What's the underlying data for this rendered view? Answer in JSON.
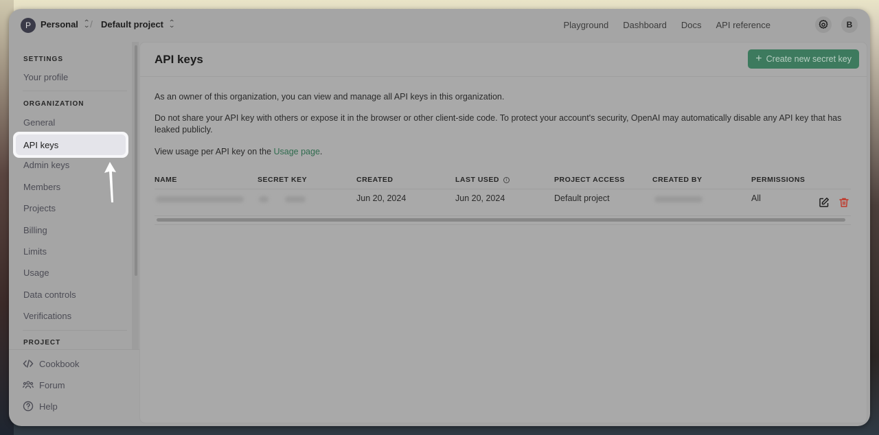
{
  "topbar": {
    "org_avatar_letter": "P",
    "org_name": "Personal",
    "project_name": "Default project",
    "nav": [
      "Playground",
      "Dashboard",
      "Docs",
      "API reference"
    ],
    "settings_icon": "gear-icon",
    "user_avatar_letter": "B"
  },
  "sidebar": {
    "settings_heading": "SETTINGS",
    "settings_items": [
      "Your profile"
    ],
    "organization_heading": "ORGANIZATION",
    "organization_items": [
      "General",
      "API keys",
      "Admin keys",
      "Members",
      "Projects",
      "Billing",
      "Limits",
      "Usage",
      "Data controls",
      "Verifications"
    ],
    "active_item": "API keys",
    "project_heading": "PROJECT",
    "footer_items": [
      {
        "label": "Cookbook",
        "icon": "code-icon"
      },
      {
        "label": "Forum",
        "icon": "users-icon"
      },
      {
        "label": "Help",
        "icon": "help-circle-icon"
      }
    ]
  },
  "main": {
    "title": "API keys",
    "create_button": "Create new secret key",
    "paragraph1": "As an owner of this organization, you can view and manage all API keys in this organization.",
    "paragraph2": "Do not share your API key with others or expose it in the browser or other client-side code. To protect your account's security, OpenAI may automatically disable any API key that has leaked publicly.",
    "paragraph3_prefix": "View usage per API key on the ",
    "paragraph3_link": "Usage page",
    "paragraph3_suffix": ".",
    "table": {
      "columns": [
        "NAME",
        "SECRET KEY",
        "CREATED",
        "LAST USED",
        "PROJECT ACCESS",
        "CREATED BY",
        "PERMISSIONS"
      ],
      "rows": [
        {
          "name": "[blurred]",
          "secret_key": "[blurred]",
          "created": "Jun 20, 2024",
          "last_used": "Jun 20, 2024",
          "project_access": "Default project",
          "created_by": "[blurred]",
          "permissions": "All"
        }
      ]
    }
  },
  "colors": {
    "accent_green": "#3d7a5e",
    "delete_red": "#c0392b",
    "link_green": "#2f6b4e"
  }
}
